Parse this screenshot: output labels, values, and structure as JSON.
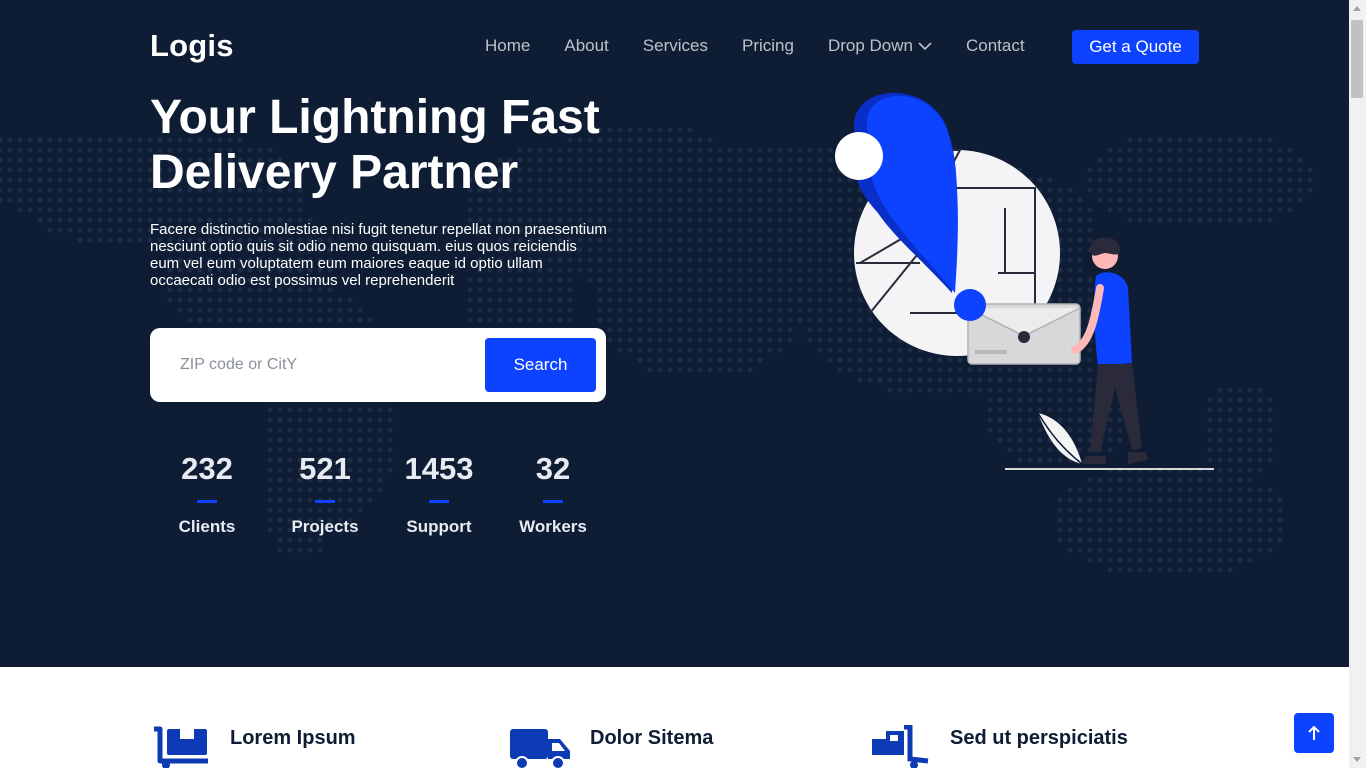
{
  "header": {
    "logo": "Logis",
    "nav": [
      "Home",
      "About",
      "Services",
      "Pricing",
      "Drop Down",
      "Contact"
    ],
    "cta": "Get a Quote"
  },
  "hero": {
    "title_line1": "Your Lightning Fast",
    "title_line2": "Delivery Partner",
    "description": "Facere distinctio molestiae nisi fugit tenetur repellat non praesentium nesciunt optio quis sit odio nemo quisquam. eius quos reiciendis eum vel eum voluptatem eum maiores eaque id optio ullam occaecati odio est possimus vel reprehenderit",
    "search": {
      "placeholder": "ZIP code or CitY",
      "button": "Search"
    },
    "stats": [
      {
        "value": "232",
        "label": "Clients"
      },
      {
        "value": "521",
        "label": "Projects"
      },
      {
        "value": "1453",
        "label": "Support"
      },
      {
        "value": "32",
        "label": "Workers"
      }
    ]
  },
  "features": [
    {
      "title": "Lorem Ipsum",
      "icon": "warehouse-icon"
    },
    {
      "title": "Dolor Sitema",
      "icon": "truck-icon"
    },
    {
      "title": "Sed ut perspiciatis",
      "icon": "hand-truck-icon"
    }
  ],
  "colors": {
    "hero_bg": "#0e1d34",
    "accent": "#0d42ff",
    "text_light": "#ffffff"
  }
}
